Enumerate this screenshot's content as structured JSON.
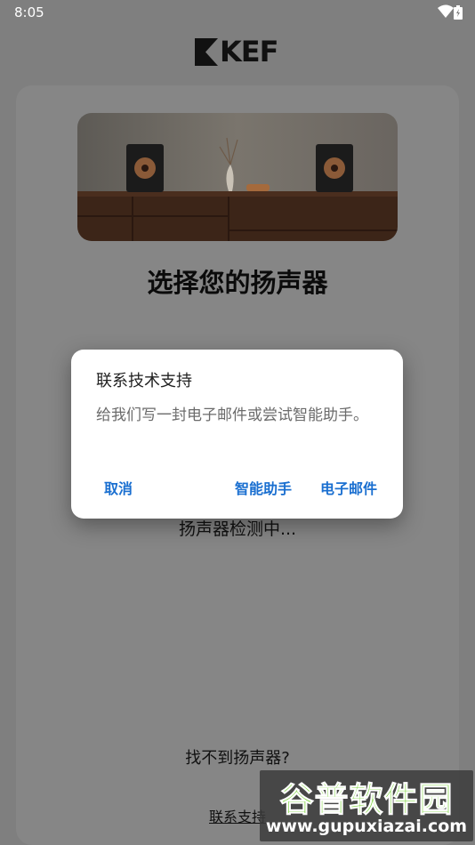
{
  "status_bar": {
    "time": "8:05"
  },
  "brand": {
    "logo_text": "KEF"
  },
  "page": {
    "title": "选择您的扬声器",
    "detecting_text": "扬声器检测中...",
    "cant_find_text": "找不到扬声器?",
    "contact_link": "联系支持"
  },
  "dialog": {
    "title": "联系技术支持",
    "message": "给我们写一封电子邮件或尝试智能助手。",
    "cancel_label": "取消",
    "assistant_label": "智能助手",
    "email_label": "电子邮件"
  },
  "watermark": {
    "name": "谷普软件园",
    "url": "www.gupuxiazai.com"
  }
}
